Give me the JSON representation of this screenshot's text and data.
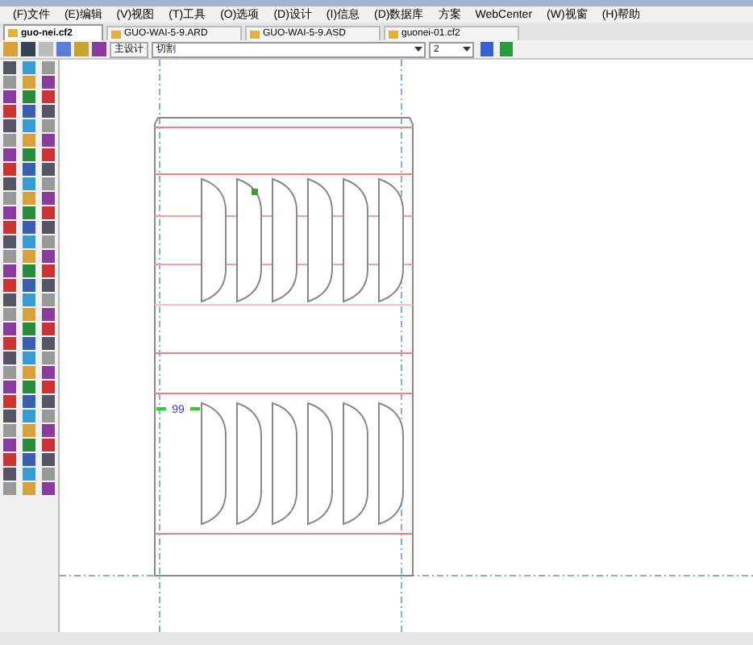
{
  "menu": [
    "(F)文件",
    "(E)编辑",
    "(V)视图",
    "(T)工具",
    "(O)选项",
    "(D)设计",
    "(I)信息",
    "(D)数据库",
    "方案",
    "WebCenter",
    "(W)视窗",
    "(H)帮助"
  ],
  "tabs": [
    {
      "label": "guo-nei.cf2",
      "selected": true
    },
    {
      "label": "GUO-WAI-5-9.ARD",
      "selected": false
    },
    {
      "label": "GUO-WAI-5-9.ASD",
      "selected": false
    },
    {
      "label": "guonei-01.cf2",
      "selected": false
    }
  ],
  "toolbar": {
    "design_button": "主设计",
    "mode_select": "切割",
    "number_select": "2"
  },
  "canvas": {
    "dimension_label": "99"
  }
}
